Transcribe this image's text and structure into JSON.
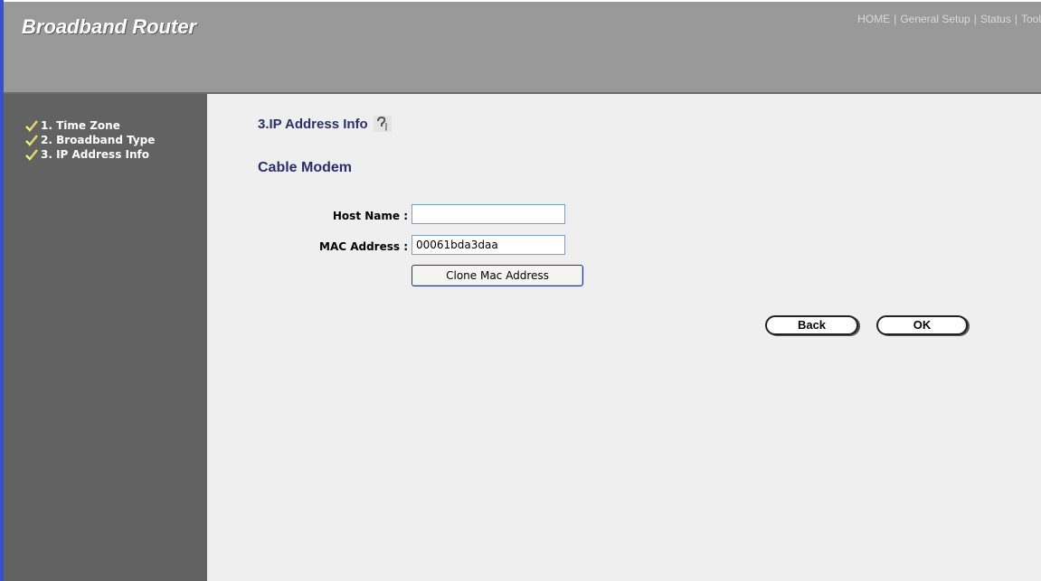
{
  "header": {
    "brand": "Broadband Router",
    "nav": [
      "HOME",
      "General Setup",
      "Status",
      "Tool"
    ]
  },
  "sidebar": {
    "items": [
      {
        "label": "1. Time Zone",
        "icon": "check-icon"
      },
      {
        "label": "2. Broadband Type",
        "icon": "check-icon"
      },
      {
        "label": "3. IP Address Info",
        "icon": "check-icon"
      }
    ]
  },
  "main": {
    "title": "3.IP Address Info",
    "help_icon": "help-icon",
    "subtitle": "Cable Modem",
    "form": {
      "host_name_label": "Host Name :",
      "host_name_value": "",
      "mac_label": "MAC Address :",
      "mac_value": "00061bda3daa",
      "clone_button": "Clone Mac Address"
    },
    "back_button": "Back",
    "ok_button": "OK"
  },
  "colors": {
    "header_bg": "#999999",
    "sidebar_bg": "#626262",
    "content_bg": "#efefef",
    "heading_color": "#2a2f6b",
    "accent_left_bar": "#3a4fd0"
  }
}
